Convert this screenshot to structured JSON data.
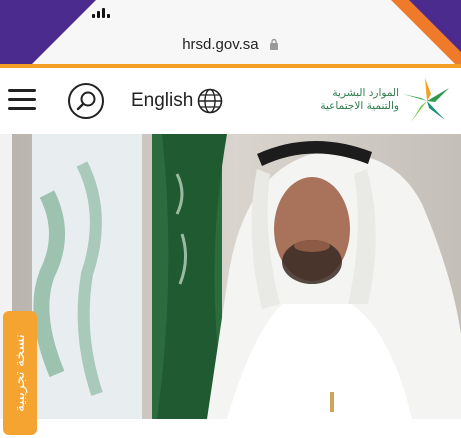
{
  "browser": {
    "url": "hrsd.gov.sa"
  },
  "header": {
    "language_label": "English",
    "logo_line1": "الموارد البشرية",
    "logo_line2": "والتنمية الاجتماعية"
  },
  "side_tab": {
    "label": "نسخة تجريبية"
  },
  "colors": {
    "accent_orange": "#f3a024",
    "brand_purple": "#4b2b8e",
    "brand_green": "#2f7d4c",
    "tab_orange": "#f5a331"
  },
  "icons": [
    "signal-icon",
    "lock-icon",
    "menu-icon",
    "search-icon",
    "globe-icon",
    "logo-star-icon"
  ]
}
